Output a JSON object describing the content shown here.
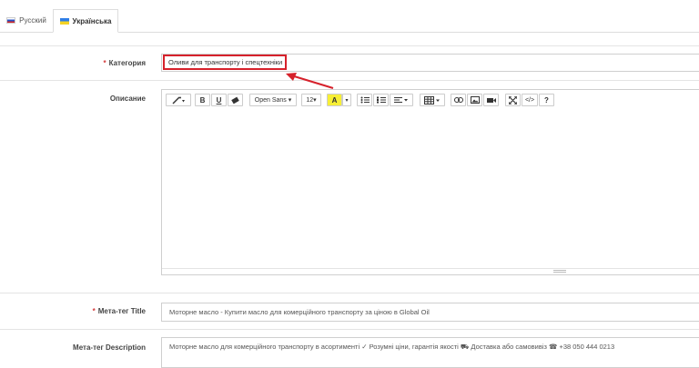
{
  "tabs": [
    {
      "label": "Русский",
      "active": false,
      "flag": "ru-flag"
    },
    {
      "label": "Українська",
      "active": true,
      "flag": "ua-flag"
    }
  ],
  "fields": {
    "category": {
      "label": "Категория",
      "required": "*",
      "value": "Оливи для транспорту і спецтехніки"
    },
    "description": {
      "label": "Описание"
    },
    "meta_title": {
      "label": "Мета-тег Title",
      "required": "*",
      "value": "Моторне масло - Купити масло для комерційного транспорту за ціною в Global Oil"
    },
    "meta_description": {
      "label": "Мета-тег Description",
      "value": "Моторне масло для комерційного транспорту в асортименті ✓ Розумні ціни, гарантія якості ⛟ Доставка або самовивіз ☎ +38 050 444 0213"
    }
  },
  "editor_toolbar": {
    "font_name": "Open Sans",
    "font_size": "12",
    "icons": [
      "magic-wand-icon",
      "bold-icon",
      "underline-icon",
      "eraser-icon",
      "font-name-dropdown",
      "font-size-dropdown",
      "text-color-icon",
      "color-dropdown-icon",
      "unordered-list-icon",
      "ordered-list-icon",
      "paragraph-align-icon",
      "table-icon",
      "link-icon",
      "picture-icon",
      "video-icon",
      "fullscreen-icon",
      "code-view-icon",
      "help-icon"
    ],
    "bold_glyph": "B",
    "underline_glyph": "U",
    "color_glyph": "A",
    "code_glyph": "</>",
    "help_glyph": "?"
  },
  "colors": {
    "highlight": "#d6212b",
    "text_color_swatch": "#f7ef36",
    "required": "#d43c3c"
  }
}
